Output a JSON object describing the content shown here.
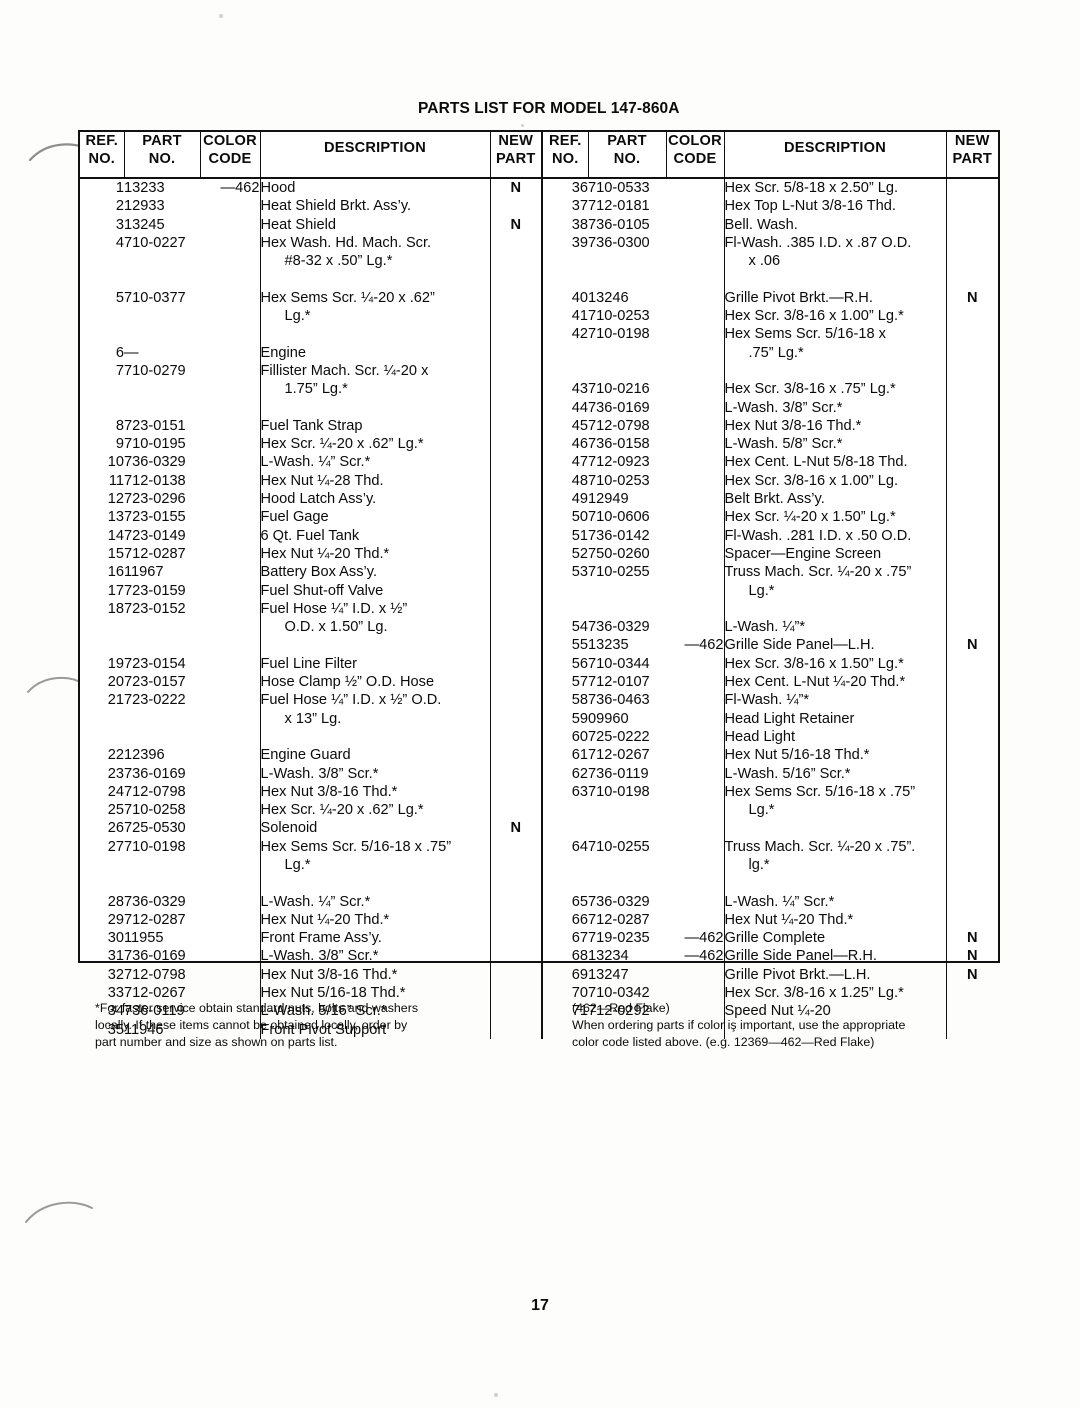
{
  "document": {
    "title": "PARTS LIST FOR MODEL 147-860A",
    "page_number": "17"
  },
  "table": {
    "headers": {
      "ref_no": "REF.\nNO.",
      "ref_no_l1": "REF.",
      "ref_no_l2": "NO.",
      "part_no_l1": "PART",
      "part_no_l2": "NO.",
      "color_code_l1": "COLOR",
      "color_code_l2": "CODE",
      "description": "DESCRIPTION",
      "new_part_l1": "NEW",
      "new_part_l2": "PART"
    },
    "left_rows": [
      {
        "ref": "1",
        "part": "13233",
        "color": "—462",
        "desc": [
          "Hood"
        ],
        "new": "N"
      },
      {
        "ref": "2",
        "part": "12933",
        "color": "",
        "desc": [
          "Heat Shield Brkt. Ass’y."
        ],
        "new": ""
      },
      {
        "ref": "3",
        "part": "13245",
        "color": "",
        "desc": [
          "Heat Shield"
        ],
        "new": "N"
      },
      {
        "ref": "4",
        "part": "710-0227",
        "color": "",
        "desc": [
          "Hex Wash. Hd. Mach. Scr.",
          "#8-32 x .50” Lg.*"
        ],
        "new": ""
      },
      {
        "ref": "5",
        "part": "710-0377",
        "color": "",
        "desc": [
          "Hex Sems Scr. ¼-20 x .62”",
          "Lg.*"
        ],
        "new": ""
      },
      {
        "ref": "6",
        "part": "—",
        "color": "",
        "desc": [
          "Engine"
        ],
        "new": ""
      },
      {
        "ref": "7",
        "part": "710-0279",
        "color": "",
        "desc": [
          "Fillister Mach. Scr. ¼-20 x",
          "1.75” Lg.*"
        ],
        "new": ""
      },
      {
        "ref": "8",
        "part": "723-0151",
        "color": "",
        "desc": [
          "Fuel Tank Strap"
        ],
        "new": ""
      },
      {
        "ref": "9",
        "part": "710-0195",
        "color": "",
        "desc": [
          "Hex Scr. ¼-20 x .62” Lg.*"
        ],
        "new": ""
      },
      {
        "ref": "10",
        "part": "736-0329",
        "color": "",
        "desc": [
          "L-Wash. ¼” Scr.*"
        ],
        "new": ""
      },
      {
        "ref": "11",
        "part": "712-0138",
        "color": "",
        "desc": [
          "Hex Nut ¼-28 Thd."
        ],
        "new": ""
      },
      {
        "ref": "12",
        "part": "723-0296",
        "color": "",
        "desc": [
          "Hood Latch Ass’y."
        ],
        "new": ""
      },
      {
        "ref": "13",
        "part": "723-0155",
        "color": "",
        "desc": [
          "Fuel Gage"
        ],
        "new": ""
      },
      {
        "ref": "14",
        "part": "723-0149",
        "color": "",
        "desc": [
          "6 Qt. Fuel Tank"
        ],
        "new": ""
      },
      {
        "ref": "15",
        "part": "712-0287",
        "color": "",
        "desc": [
          "Hex Nut ¼-20 Thd.*"
        ],
        "new": ""
      },
      {
        "ref": "16",
        "part": "11967",
        "color": "",
        "desc": [
          "Battery Box Ass’y."
        ],
        "new": ""
      },
      {
        "ref": "17",
        "part": "723-0159",
        "color": "",
        "desc": [
          "Fuel Shut-off Valve"
        ],
        "new": ""
      },
      {
        "ref": "18",
        "part": "723-0152",
        "color": "",
        "desc": [
          "Fuel Hose ¼” I.D. x ½”",
          "O.D. x 1.50” Lg."
        ],
        "new": ""
      },
      {
        "ref": "19",
        "part": "723-0154",
        "color": "",
        "desc": [
          "Fuel Line Filter"
        ],
        "new": ""
      },
      {
        "ref": "20",
        "part": "723-0157",
        "color": "",
        "desc": [
          "Hose Clamp ½” O.D. Hose"
        ],
        "new": ""
      },
      {
        "ref": "21",
        "part": "723-0222",
        "color": "",
        "desc": [
          "Fuel Hose ¼” I.D. x ½” O.D.",
          "x 13” Lg."
        ],
        "new": ""
      },
      {
        "ref": "22",
        "part": "12396",
        "color": "",
        "desc": [
          "Engine Guard"
        ],
        "new": ""
      },
      {
        "ref": "23",
        "part": "736-0169",
        "color": "",
        "desc": [
          "L-Wash. 3/8” Scr.*"
        ],
        "new": ""
      },
      {
        "ref": "24",
        "part": "712-0798",
        "color": "",
        "desc": [
          "Hex Nut 3/8-16 Thd.*"
        ],
        "new": ""
      },
      {
        "ref": "25",
        "part": "710-0258",
        "color": "",
        "desc": [
          "Hex Scr. ¼-20 x .62” Lg.*"
        ],
        "new": ""
      },
      {
        "ref": "26",
        "part": "725-0530",
        "color": "",
        "desc": [
          "Solenoid"
        ],
        "new": "N"
      },
      {
        "ref": "27",
        "part": "710-0198",
        "color": "",
        "desc": [
          "Hex Sems Scr. 5/16-18 x .75”",
          "Lg.*"
        ],
        "new": ""
      },
      {
        "ref": "28",
        "part": "736-0329",
        "color": "",
        "desc": [
          "L-Wash. ¼” Scr.*"
        ],
        "new": ""
      },
      {
        "ref": "29",
        "part": "712-0287",
        "color": "",
        "desc": [
          "Hex Nut ¼-20 Thd.*"
        ],
        "new": ""
      },
      {
        "ref": "30",
        "part": "11955",
        "color": "",
        "desc": [
          "Front Frame Ass’y."
        ],
        "new": ""
      },
      {
        "ref": "31",
        "part": "736-0169",
        "color": "",
        "desc": [
          "L-Wash. 3/8” Scr.*"
        ],
        "new": ""
      },
      {
        "ref": "32",
        "part": "712-0798",
        "color": "",
        "desc": [
          "Hex Nut 3/8-16 Thd.*"
        ],
        "new": ""
      },
      {
        "ref": "33",
        "part": "712-0267",
        "color": "",
        "desc": [
          "Hex Nut 5/16-18 Thd.*"
        ],
        "new": ""
      },
      {
        "ref": "34",
        "part": "736-0119",
        "color": "",
        "desc": [
          "L-Wash. 5/16” Scr.*"
        ],
        "new": ""
      },
      {
        "ref": "35",
        "part": "11946",
        "color": "",
        "desc": [
          "Front Pivot Support"
        ],
        "new": ""
      }
    ],
    "right_rows": [
      {
        "ref": "36",
        "part": "710-0533",
        "color": "",
        "desc": [
          "Hex Scr. 5/8-18 x 2.50” Lg."
        ],
        "new": ""
      },
      {
        "ref": "37",
        "part": "712-0181",
        "color": "",
        "desc": [
          "Hex Top L-Nut 3/8-16 Thd."
        ],
        "new": ""
      },
      {
        "ref": "38",
        "part": "736-0105",
        "color": "",
        "desc": [
          "Bell. Wash."
        ],
        "new": ""
      },
      {
        "ref": "39",
        "part": "736-0300",
        "color": "",
        "desc": [
          "Fl-Wash. .385 I.D. x .87 O.D.",
          "x .06"
        ],
        "new": ""
      },
      {
        "ref": "40",
        "part": "13246",
        "color": "",
        "desc": [
          "Grille Pivot Brkt.—R.H."
        ],
        "new": "N"
      },
      {
        "ref": "41",
        "part": "710-0253",
        "color": "",
        "desc": [
          "Hex Scr. 3/8-16 x 1.00” Lg.*"
        ],
        "new": ""
      },
      {
        "ref": "42",
        "part": "710-0198",
        "color": "",
        "desc": [
          "Hex Sems Scr. 5/16-18 x",
          ".75” Lg.*"
        ],
        "new": ""
      },
      {
        "ref": "43",
        "part": "710-0216",
        "color": "",
        "desc": [
          "Hex Scr. 3/8-16 x .75” Lg.*"
        ],
        "new": ""
      },
      {
        "ref": "44",
        "part": "736-0169",
        "color": "",
        "desc": [
          "L-Wash. 3/8” Scr.*"
        ],
        "new": ""
      },
      {
        "ref": "45",
        "part": "712-0798",
        "color": "",
        "desc": [
          "Hex Nut 3/8-16 Thd.*"
        ],
        "new": ""
      },
      {
        "ref": "46",
        "part": "736-0158",
        "color": "",
        "desc": [
          "L-Wash. 5/8” Scr.*"
        ],
        "new": ""
      },
      {
        "ref": "47",
        "part": "712-0923",
        "color": "",
        "desc": [
          "Hex Cent. L-Nut 5/8-18 Thd."
        ],
        "new": ""
      },
      {
        "ref": "48",
        "part": "710-0253",
        "color": "",
        "desc": [
          "Hex Scr. 3/8-16 x 1.00” Lg."
        ],
        "new": ""
      },
      {
        "ref": "49",
        "part": "12949",
        "color": "",
        "desc": [
          "Belt Brkt. Ass’y."
        ],
        "new": ""
      },
      {
        "ref": "50",
        "part": "710-0606",
        "color": "",
        "desc": [
          "Hex Scr. ¼-20 x 1.50” Lg.*"
        ],
        "new": ""
      },
      {
        "ref": "51",
        "part": "736-0142",
        "color": "",
        "desc": [
          "Fl-Wash. .281 I.D. x .50 O.D."
        ],
        "new": ""
      },
      {
        "ref": "52",
        "part": "750-0260",
        "color": "",
        "desc": [
          "Spacer—Engine Screen"
        ],
        "new": ""
      },
      {
        "ref": "53",
        "part": "710-0255",
        "color": "",
        "desc": [
          "Truss Mach. Scr. ¼-20 x .75”",
          "Lg.*"
        ],
        "new": ""
      },
      {
        "ref": "54",
        "part": "736-0329",
        "color": "",
        "desc": [
          "L-Wash. ¼”*"
        ],
        "new": ""
      },
      {
        "ref": "55",
        "part": "13235",
        "color": "—462",
        "desc": [
          "Grille Side Panel—L.H."
        ],
        "new": "N"
      },
      {
        "ref": "56",
        "part": "710-0344",
        "color": "",
        "desc": [
          "Hex Scr. 3/8-16 x 1.50” Lg.*"
        ],
        "new": ""
      },
      {
        "ref": "57",
        "part": "712-0107",
        "color": "",
        "desc": [
          "Hex Cent. L-Nut ¼-20 Thd.*"
        ],
        "new": ""
      },
      {
        "ref": "58",
        "part": "736-0463",
        "color": "",
        "desc": [
          "Fl-Wash. ¼”*"
        ],
        "new": ""
      },
      {
        "ref": "59",
        "part": "09960",
        "color": "",
        "desc": [
          "Head Light Retainer"
        ],
        "new": ""
      },
      {
        "ref": "60",
        "part": "725-0222",
        "color": "",
        "desc": [
          "Head Light"
        ],
        "new": ""
      },
      {
        "ref": "61",
        "part": "712-0267",
        "color": "",
        "desc": [
          "Hex Nut 5/16-18 Thd.*"
        ],
        "new": ""
      },
      {
        "ref": "62",
        "part": "736-0119",
        "color": "",
        "desc": [
          "L-Wash. 5/16” Scr.*"
        ],
        "new": ""
      },
      {
        "ref": "63",
        "part": "710-0198",
        "color": "",
        "desc": [
          "Hex Sems Scr. 5/16-18 x .75”",
          "Lg.*"
        ],
        "new": ""
      },
      {
        "ref": "64",
        "part": "710-0255",
        "color": "",
        "desc": [
          "Truss Mach. Scr. ¼-20 x .75”.",
          "lg.*"
        ],
        "new": ""
      },
      {
        "ref": "65",
        "part": "736-0329",
        "color": "",
        "desc": [
          "L-Wash. ¼” Scr.*"
        ],
        "new": ""
      },
      {
        "ref": "66",
        "part": "712-0287",
        "color": "",
        "desc": [
          "Hex Nut ¼-20 Thd.*"
        ],
        "new": ""
      },
      {
        "ref": "67",
        "part": "719-0235",
        "color": "—462",
        "desc": [
          "Grille Complete"
        ],
        "new": "N"
      },
      {
        "ref": "68",
        "part": "13234",
        "color": "—462",
        "desc": [
          "Grille Side Panel—R.H."
        ],
        "new": "N"
      },
      {
        "ref": "69",
        "part": "13247",
        "color": "",
        "desc": [
          "Grille Pivot Brkt.—L.H."
        ],
        "new": "N"
      },
      {
        "ref": "70",
        "part": "710-0342",
        "color": "",
        "desc": [
          "Hex Scr. 3/8-16 x 1.25” Lg.*"
        ],
        "new": ""
      },
      {
        "ref": "71",
        "part": "712-0292",
        "color": "",
        "desc": [
          "Speed Nut ¼-20"
        ],
        "new": ""
      }
    ]
  },
  "footnotes": {
    "left": [
      "*For faster service obtain standard nuts, bolts and washers",
      "locally. If these items cannot be obtained locally, order by",
      "part number and size as shown on parts list."
    ],
    "right": [
      "(462—Red Flake)",
      "When ordering parts if color iş important, use the appropriate",
      "color code listed above. (e.g. 12369—462—Red Flake)"
    ]
  }
}
